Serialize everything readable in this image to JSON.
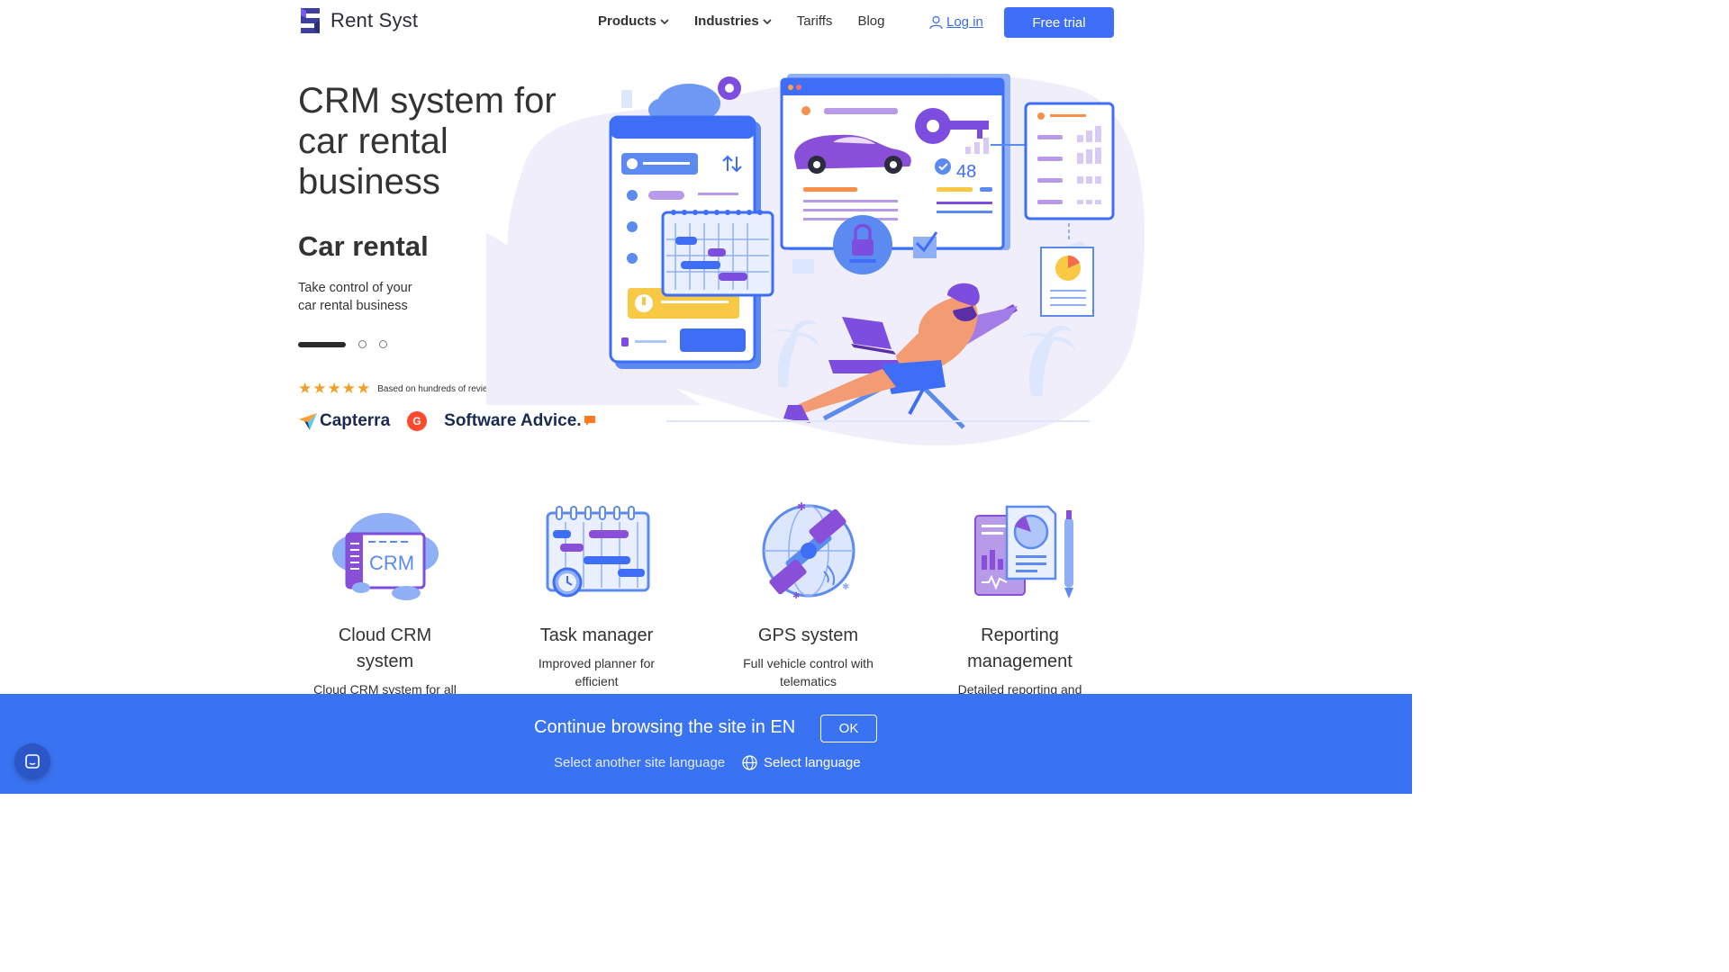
{
  "header": {
    "logo_text": "Rent Syst",
    "nav": [
      {
        "label": "Products",
        "dropdown": true
      },
      {
        "label": "Industries",
        "dropdown": true
      },
      {
        "label": "Tariffs",
        "dropdown": false
      },
      {
        "label": "Blog",
        "dropdown": false
      }
    ],
    "login_label": "Log in",
    "free_trial_label": "Free trial"
  },
  "hero": {
    "title": "CRM system for car rental business",
    "slide_title": "Car rental",
    "slide_desc": "Take control of your car rental business",
    "slides_count": 3,
    "active_slide": 0,
    "rating_stars": 5,
    "reviews_text": "Based on hundreds of reviews on",
    "brands": [
      "Capterra",
      "Software Advice."
    ],
    "illustration_counter": "48"
  },
  "features": [
    {
      "title": "Cloud CRM system",
      "desc": "Cloud CRM system for all types",
      "icon": "cloud-crm-icon",
      "icon_label": "CRM"
    },
    {
      "title": "Task manager",
      "desc": "Improved planner for efficient",
      "icon": "task-manager-icon"
    },
    {
      "title": "GPS system",
      "desc": "Full vehicle control with telematics",
      "icon": "gps-satellite-icon"
    },
    {
      "title": "Reporting management",
      "desc": "Detailed reporting and",
      "icon": "reporting-icon"
    }
  ],
  "lang_banner": {
    "text": "Continue browsing the site in EN",
    "ok_label": "OK",
    "sub_text": "Select another site language",
    "select_label": "Select language"
  },
  "colors": {
    "primary": "#3d6ef5",
    "banner": "#3a73f1",
    "purple": "#8a4fd8",
    "star": "#f2a02a"
  }
}
